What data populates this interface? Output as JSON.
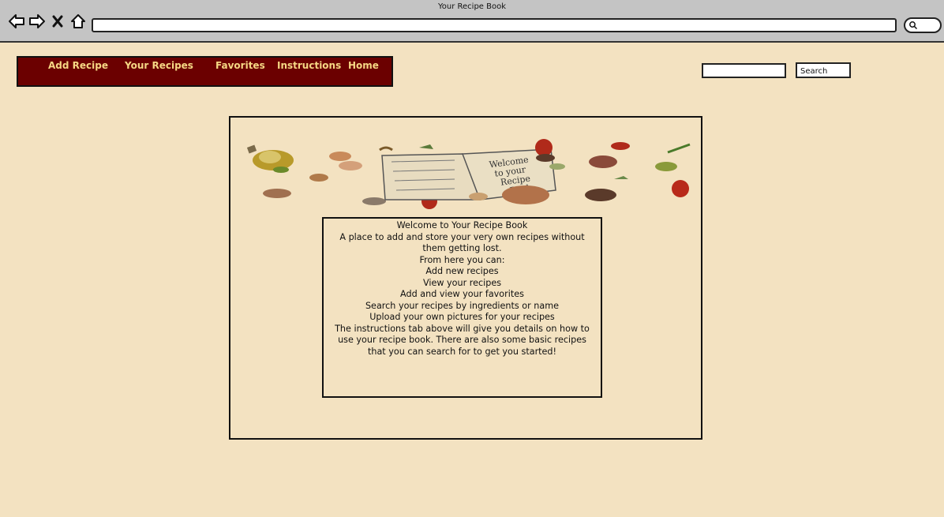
{
  "window": {
    "title": "Your Recipe Book"
  },
  "browser": {
    "icons": [
      "back-arrow-icon",
      "forward-arrow-icon",
      "close-icon",
      "home-icon",
      "search-icon"
    ]
  },
  "nav": {
    "items": [
      {
        "label": "Add Recipe"
      },
      {
        "label": "Your Recipes"
      },
      {
        "label": "Favorites"
      },
      {
        "label": "Instructions"
      },
      {
        "label": "Home"
      }
    ]
  },
  "search": {
    "placeholder": "",
    "button_label": "Search"
  },
  "colors": {
    "page_bg": "#f3e2c1",
    "nav_bg": "#6b0000",
    "nav_text": "#f5d784"
  },
  "banner": {
    "book_text": "Welcome to your Recipe Book"
  },
  "welcome": {
    "lines": [
      "Welcome to Your Recipe Book",
      "A place to add and store your very own recipes without them getting lost.",
      "From here you can:",
      "Add new recipes",
      "View your recipes",
      "Add and view your favorites",
      "Search your recipes by ingredients or name",
      "Upload your own pictures for your recipes",
      "The instructions tab above will give you details on how to use your recipe book. There are also some basic recipes that you can search for to get you started!"
    ]
  }
}
